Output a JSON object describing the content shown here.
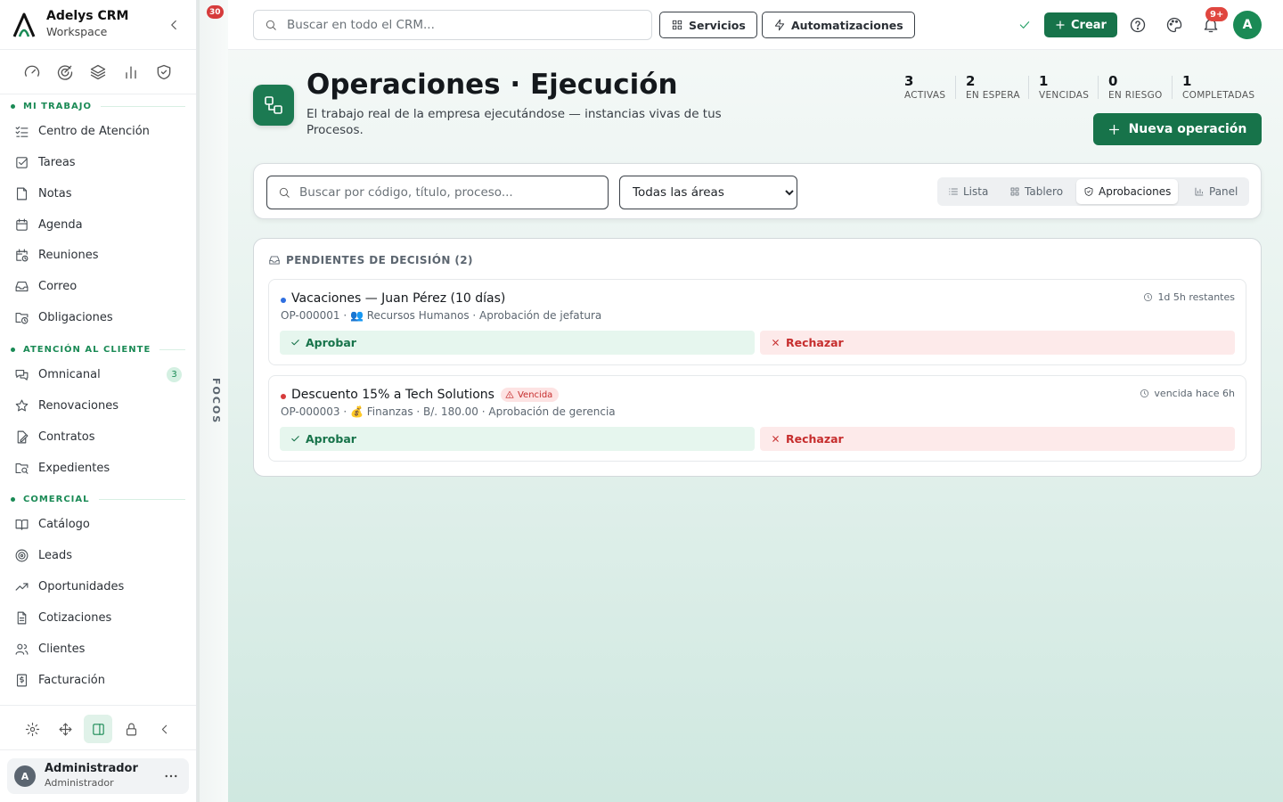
{
  "brand": {
    "name": "Adelys CRM",
    "workspace": "Workspace"
  },
  "sidebar": {
    "sections": [
      {
        "label": "MI TRABAJO",
        "items": [
          {
            "label": "Centro de Atención",
            "icon": "list-check-icon"
          },
          {
            "label": "Tareas",
            "icon": "checkbox-icon"
          },
          {
            "label": "Notas",
            "icon": "note-icon"
          },
          {
            "label": "Agenda",
            "icon": "calendar-icon"
          },
          {
            "label": "Reuniones",
            "icon": "calendar-clock-icon"
          },
          {
            "label": "Correo",
            "icon": "inbox-icon"
          },
          {
            "label": "Obligaciones",
            "icon": "folder-clock-icon"
          }
        ]
      },
      {
        "label": "ATENCIÓN AL CLIENTE",
        "items": [
          {
            "label": "Omnicanal",
            "icon": "chat-icon",
            "badge": "3"
          },
          {
            "label": "Renovaciones",
            "icon": "star-icon"
          },
          {
            "label": "Contratos",
            "icon": "file-signature-icon"
          },
          {
            "label": "Expedientes",
            "icon": "folder-search-icon"
          }
        ]
      },
      {
        "label": "COMERCIAL",
        "items": [
          {
            "label": "Catálogo",
            "icon": "book-open-icon"
          },
          {
            "label": "Leads",
            "icon": "target-icon"
          },
          {
            "label": "Oportunidades",
            "icon": "trending-up-icon"
          },
          {
            "label": "Cotizaciones",
            "icon": "file-text-icon"
          },
          {
            "label": "Clientes",
            "icon": "users-icon"
          },
          {
            "label": "Facturación",
            "icon": "receipt-icon"
          }
        ]
      }
    ]
  },
  "user": {
    "initial": "A",
    "name": "Administrador",
    "role": "Administrador"
  },
  "focos": {
    "label": "FOCOS",
    "count": "30"
  },
  "topbar": {
    "search_placeholder": "Buscar en todo el CRM...",
    "servicios": "Servicios",
    "automatizaciones": "Automatizaciones",
    "crear": "Crear",
    "notifications_badge": "9+",
    "avatar": "A"
  },
  "header": {
    "title": "Operaciones · Ejecución",
    "subtitle": "El trabajo real de la empresa ejecutándose — instancias vivas de tus Procesos.",
    "new_button": "Nueva operación",
    "stats": [
      {
        "value": "3",
        "label": "ACTIVAS"
      },
      {
        "value": "2",
        "label": "EN ESPERA"
      },
      {
        "value": "1",
        "label": "VENCIDAS"
      },
      {
        "value": "0",
        "label": "EN RIESGO"
      },
      {
        "value": "1",
        "label": "COMPLETADAS"
      }
    ]
  },
  "filters": {
    "search_placeholder": "Buscar por código, título, proceso...",
    "area_selected": "Todas las áreas",
    "views": [
      "Lista",
      "Tablero",
      "Aprobaciones",
      "Panel"
    ],
    "active_view": "Aprobaciones"
  },
  "pending": {
    "title": "PENDIENTES DE DECISIÓN (2)",
    "approve_label": "Aprobar",
    "reject_label": "Rechazar",
    "items": [
      {
        "title": "Vacaciones — Juan Pérez (10 días)",
        "meta": "OP-000001 · 👥 Recursos Humanos · Aprobación de jefatura",
        "time": "1d 5h restantes",
        "tag": "",
        "dot_color": "#2f6fe0"
      },
      {
        "title": "Descuento 15% a Tech Solutions",
        "meta": "OP-000003 · 💰 Finanzas · B/. 180.00 · Aprobación de gerencia",
        "time": "vencida hace 6h",
        "tag": "Vencida",
        "dot_color": "#d63b3b"
      }
    ]
  },
  "colors": {
    "accent": "#17734a",
    "danger": "#c62d2d"
  }
}
